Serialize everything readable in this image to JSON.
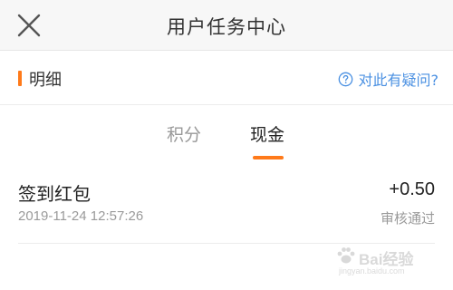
{
  "header": {
    "title": "用户任务中心"
  },
  "section": {
    "label": "明细",
    "faq_link": "对此有疑问?"
  },
  "tabs": [
    {
      "label": "积分",
      "active": false
    },
    {
      "label": "现金",
      "active": true
    }
  ],
  "records": [
    {
      "title": "签到红包",
      "time": "2019-11-24 12:57:26",
      "amount": "+0.50",
      "status": "审核通过"
    }
  ],
  "watermark": {
    "brand": "Bai经验",
    "sub": "jingyan.baidu.com"
  },
  "colors": {
    "accent": "#ff7a1a",
    "link": "#4a90e2",
    "muted": "#9a9a9a"
  }
}
